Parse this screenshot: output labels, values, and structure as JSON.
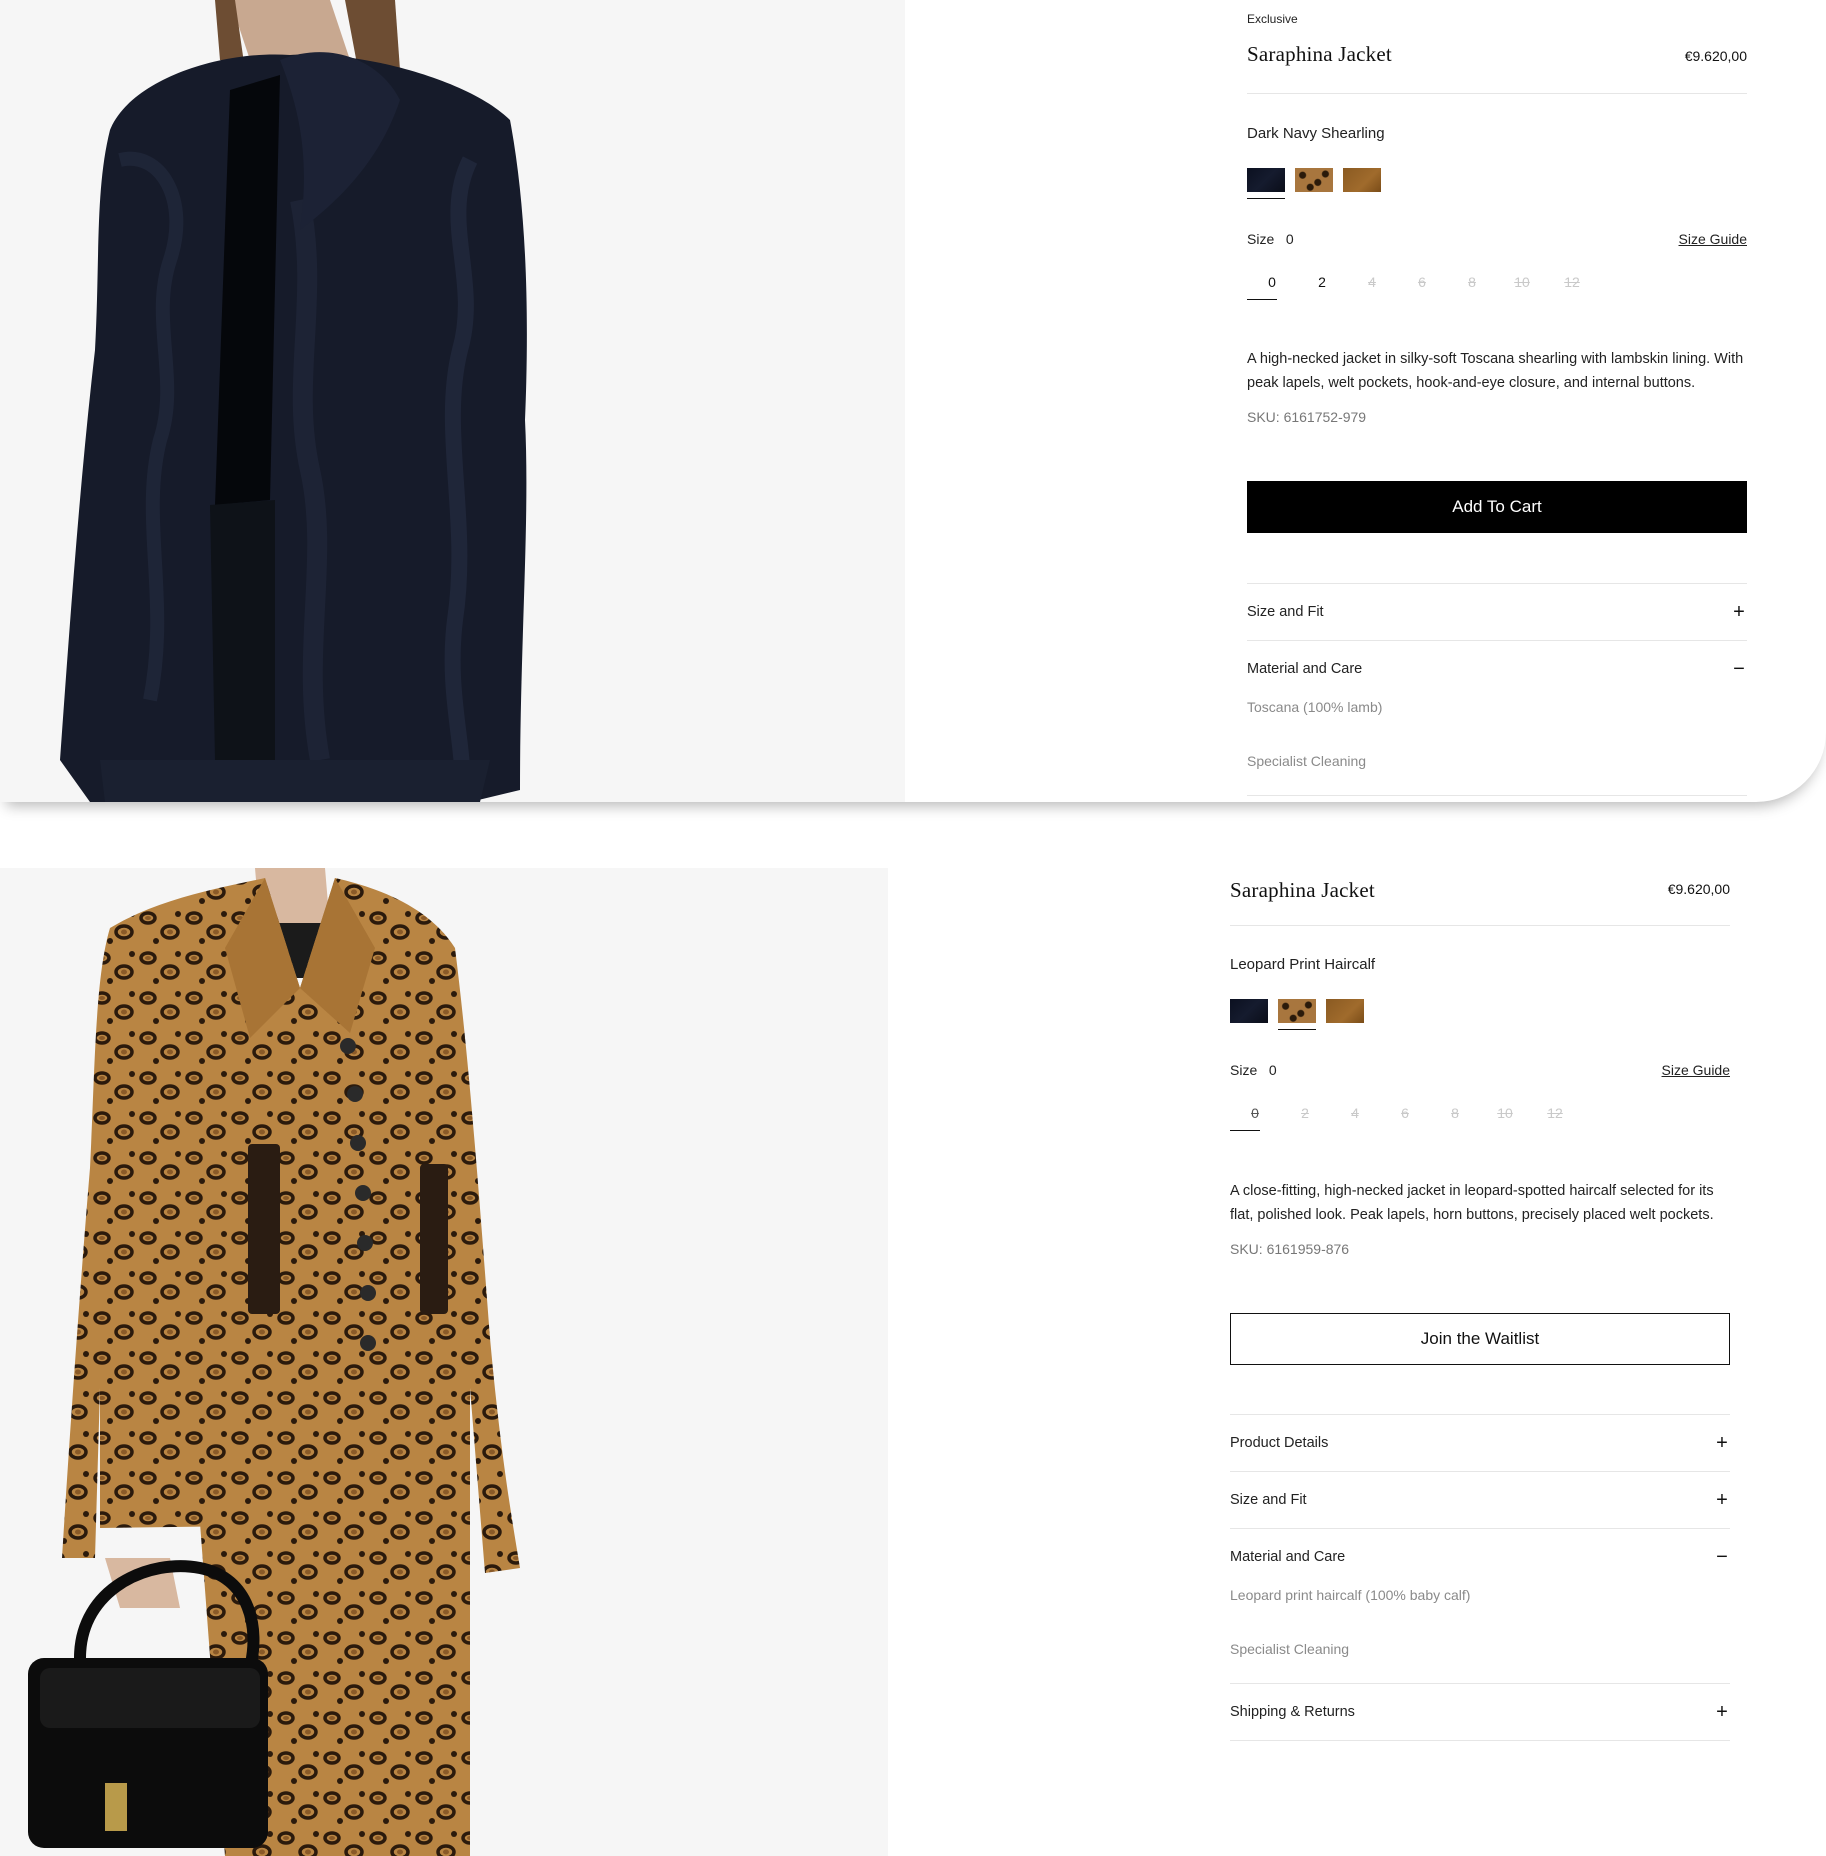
{
  "product1": {
    "eyebrow": "Exclusive",
    "title": "Saraphina Jacket",
    "price": "€9.620,00",
    "color_name": "Dark Navy Shearling",
    "swatches": [
      "dark-navy",
      "leopard",
      "brown"
    ],
    "selected_swatch": "dark-navy",
    "size_label": "Size",
    "size_value": "0",
    "size_guide": "Size Guide",
    "sizes": [
      "0",
      "2",
      "4",
      "6",
      "8",
      "10",
      "12"
    ],
    "available_sizes": [
      "0",
      "2"
    ],
    "description": "A high-necked jacket in silky-soft Toscana shearling with lambskin lining. With peak lapels, welt pockets, hook-and-eye closure, and internal buttons.",
    "sku": "SKU: 6161752-979",
    "cta": "Add To Cart",
    "accordion": [
      {
        "label": "Size and Fit",
        "sign": "+"
      },
      {
        "label": "Material and Care",
        "sign": "−"
      }
    ],
    "material": "Toscana (100% lamb)",
    "care": "Specialist Cleaning"
  },
  "product2": {
    "title": "Saraphina Jacket",
    "price": "€9.620,00",
    "color_name": "Leopard Print Haircalf",
    "swatches": [
      "dark-navy",
      "leopard",
      "brown"
    ],
    "selected_swatch": "leopard",
    "size_label": "Size",
    "size_value": "0",
    "size_guide": "Size Guide",
    "sizes": [
      "0",
      "2",
      "4",
      "6",
      "8",
      "10",
      "12"
    ],
    "available_sizes": [],
    "description": "A close-fitting, high-necked jacket in leopard-spotted haircalf selected for its flat, polished look. Peak lapels, horn buttons, precisely placed welt pockets.",
    "sku": "SKU: 6161959-876",
    "cta": "Join the Waitlist",
    "accordion": [
      {
        "label": "Product Details",
        "sign": "+"
      },
      {
        "label": "Size and Fit",
        "sign": "+"
      },
      {
        "label": "Material and Care",
        "sign": "−"
      },
      {
        "label": "Shipping & Returns",
        "sign": "+"
      }
    ],
    "material": "Leopard print haircalf (100% baby calf)",
    "care": "Specialist Cleaning"
  },
  "colors": {
    "cta_bg": "#000000",
    "muted_text": "#8a8a8a",
    "rule": "#e6e6e6",
    "image_bg": "#f6f6f6"
  }
}
